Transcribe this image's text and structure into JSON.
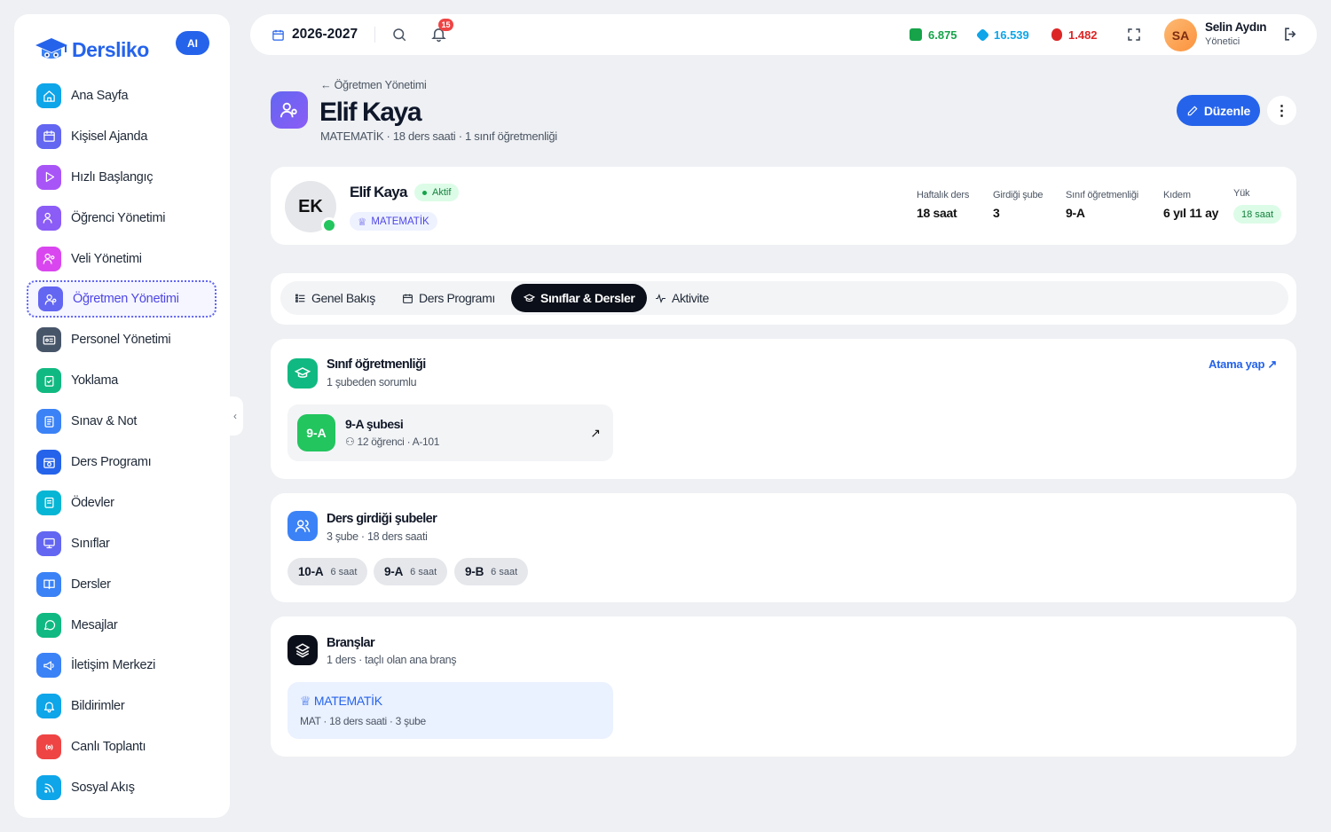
{
  "brand": {
    "name": "Dersliko",
    "ai_badge": "AI",
    "primary": "#2563eb"
  },
  "sidebar": {
    "items": [
      {
        "label": "Ana Sayfa",
        "icon": "home-icon",
        "color": "#0ea5e9"
      },
      {
        "label": "Kişisel Ajanda",
        "icon": "calendar-icon",
        "color": "#6366f1"
      },
      {
        "label": "Hızlı Başlangıç",
        "icon": "play-icon",
        "color": "#a855f7"
      },
      {
        "label": "Öğrenci Yönetimi",
        "icon": "users-icon",
        "color": "#8b5cf6"
      },
      {
        "label": "Veli Yönetimi",
        "icon": "parent-icon",
        "color": "#d946ef"
      },
      {
        "label": "Öğretmen Yönetimi",
        "icon": "teacher-icon",
        "color": "#6366f1",
        "active": true
      },
      {
        "label": "Personel Yönetimi",
        "icon": "id-card-icon",
        "color": "#475569"
      },
      {
        "label": "Yoklama",
        "icon": "clipboard-check-icon",
        "color": "#10b981"
      },
      {
        "label": "Sınav & Not",
        "icon": "exam-icon",
        "color": "#3b82f6"
      },
      {
        "label": "Ders Programı",
        "icon": "schedule-icon",
        "color": "#2563eb"
      },
      {
        "label": "Ödevler",
        "icon": "homework-icon",
        "color": "#06b6d4"
      },
      {
        "label": "Sınıflar",
        "icon": "monitor-icon",
        "color": "#6366f1"
      },
      {
        "label": "Dersler",
        "icon": "book-icon",
        "color": "#3b82f6"
      },
      {
        "label": "Mesajlar",
        "icon": "message-icon",
        "color": "#10b981"
      },
      {
        "label": "İletişim Merkezi",
        "icon": "megaphone-icon",
        "color": "#3b82f6"
      },
      {
        "label": "Bildirimler",
        "icon": "bell-icon",
        "color": "#0ea5e9"
      },
      {
        "label": "Canlı Toplantı",
        "icon": "broadcast-icon",
        "color": "#ef4444"
      },
      {
        "label": "Sosyal Akış",
        "icon": "rss-icon",
        "color": "#0ea5e9"
      }
    ]
  },
  "topbar": {
    "year": "2026-2027",
    "notifications": "15",
    "stats": [
      {
        "value": "6.875",
        "color": "#16a34a",
        "icon": "cash-icon"
      },
      {
        "value": "16.539",
        "color": "#0ea5e9",
        "icon": "gem-icon"
      },
      {
        "value": "1.482",
        "color": "#dc2626",
        "icon": "fire-icon"
      }
    ],
    "user": {
      "initials": "SA",
      "name": "Selin Aydın",
      "role": "Yönetici"
    }
  },
  "header": {
    "back": "Öğretmen Yönetimi",
    "title": "Elif Kaya",
    "subtitle": "MATEMATİK · 18 ders saati · 1 sınıf öğretmenliği",
    "edit_label": "Düzenle"
  },
  "profile": {
    "initials": "EK",
    "name": "Elif Kaya",
    "status": "Aktif",
    "branch": "MATEMATİK",
    "stats": [
      {
        "label": "Haftalık ders",
        "value": "18 saat"
      },
      {
        "label": "Girdiği şube",
        "value": "3"
      },
      {
        "label": "Sınıf öğretmenliği",
        "value": "9-A"
      },
      {
        "label": "Kıdem",
        "value": "6 yıl 11 ay"
      }
    ],
    "load": {
      "label": "Yük",
      "value": "18 saat"
    }
  },
  "tabs": [
    {
      "label": "Genel Bakış"
    },
    {
      "label": "Ders Programı"
    },
    {
      "label": "Sınıflar & Dersler",
      "active": true
    },
    {
      "label": "Aktivite"
    }
  ],
  "homeroom": {
    "title": "Sınıf öğretmenliği",
    "subtitle": "1 şubeden sorumlu",
    "action": "Atama yap ↗",
    "class": {
      "code": "9-A",
      "name": "9-A şubesi",
      "meta": "12 öğrenci · A-101"
    }
  },
  "sections_taught": {
    "title": "Ders girdiği şubeler",
    "subtitle": "3 şube · 18 ders saati",
    "chips": [
      {
        "code": "10-A",
        "hours": "6 saat"
      },
      {
        "code": "9-A",
        "hours": "6 saat"
      },
      {
        "code": "9-B",
        "hours": "6 saat"
      }
    ]
  },
  "branches": {
    "title": "Branşlar",
    "subtitle": "1 ders · taçlı olan ana branş",
    "item": {
      "name": "MATEMATİK",
      "meta": "MAT · 18 ders saati · 3 şube"
    }
  }
}
